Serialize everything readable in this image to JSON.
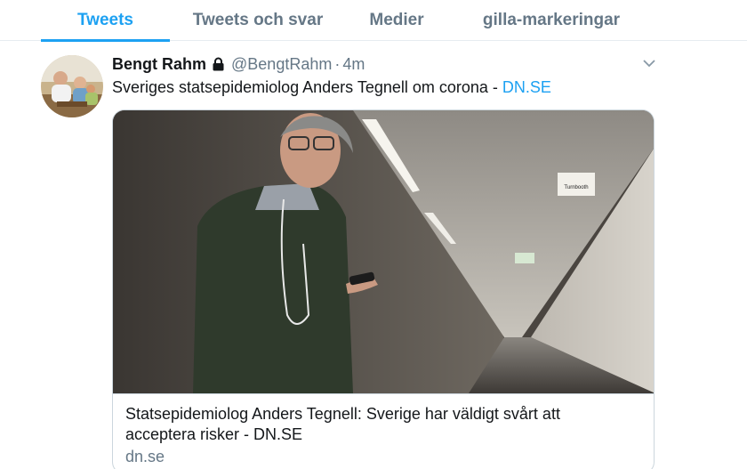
{
  "tabs": [
    {
      "label": "Tweets"
    },
    {
      "label": "Tweets och svar"
    },
    {
      "label": "Medier"
    },
    {
      "label": "gilla-markeringar"
    }
  ],
  "tweet": {
    "author_name": "Bengt Rahm",
    "handle": "@BengtRahm",
    "separator": "·",
    "time": "4m",
    "text": "Sveriges statsepidemiolog Anders Tegnell om corona - ",
    "link_text": "DN.SE",
    "icons": {
      "protected": "lock-icon",
      "menu": "chevron-down-icon"
    }
  },
  "card": {
    "title": "Statsepidemiolog Anders Tegnell: Sverige har väldigt svårt att acceptera risker - DN.SE",
    "domain": "dn.se",
    "sign_text": "Turnbooth"
  },
  "colors": {
    "accent": "#1da1f2",
    "secondary_text": "#657786",
    "border": "#e6ecf0"
  }
}
